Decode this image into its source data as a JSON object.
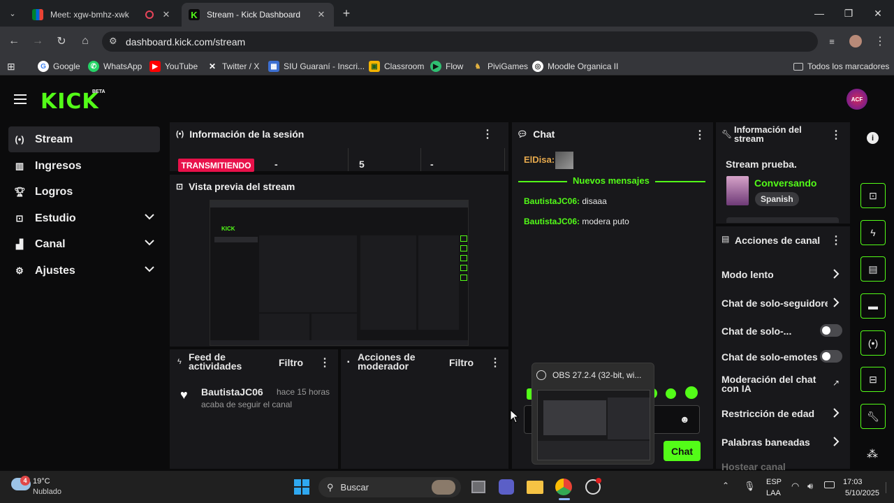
{
  "browser": {
    "tabs": [
      {
        "title": "Meet: xgw-bmhz-xwk",
        "active": false
      },
      {
        "title": "Stream - Kick Dashboard",
        "active": true
      }
    ],
    "url": "dashboard.kick.com/stream",
    "bookmarks": [
      "Google",
      "WhatsApp",
      "YouTube",
      "Twitter / X",
      "SIU Guaraní - Inscri...",
      "Classroom",
      "Flow",
      "PiviGames",
      "Moodle Organica II"
    ],
    "all_bookmarks": "Todos los marcadores"
  },
  "app": {
    "brand": "KICK",
    "beta": "BETA",
    "accent": "#53fc18",
    "avatar_text": "ACF",
    "nav": [
      {
        "label": "Stream",
        "icon": "broadcast-icon",
        "active": true
      },
      {
        "label": "Ingresos",
        "icon": "chart-icon"
      },
      {
        "label": "Logros",
        "icon": "trophy-icon"
      },
      {
        "label": "Estudio",
        "icon": "studio-icon",
        "expandable": true
      },
      {
        "label": "Canal",
        "icon": "user-icon",
        "expandable": true
      },
      {
        "label": "Ajustes",
        "icon": "gear-icon",
        "expandable": true
      }
    ]
  },
  "session": {
    "title": "Información de la sesión",
    "status": "TRANSMITIENDO",
    "stats": [
      "-",
      "5",
      "-"
    ]
  },
  "preview": {
    "title": "Vista previa del stream"
  },
  "feed": {
    "title": "Feed de actividades",
    "filter": "Filtro",
    "items": [
      {
        "user": "BautistaJC06",
        "time": "hace 15 horas",
        "text": "acaba de seguir el canal"
      }
    ]
  },
  "modactions": {
    "title": "Acciones de moderador",
    "filter": "Filtro"
  },
  "chat": {
    "title": "Chat",
    "first_user": "ElDisa:",
    "new_messages": "Nuevos mensajes",
    "messages": [
      {
        "user": "BautistaJC06:",
        "text": "disaaa"
      },
      {
        "user": "BautistaJC06:",
        "text": "modera puto"
      }
    ],
    "send_label": "Chat"
  },
  "streaminfo": {
    "title": "Información del stream",
    "stream_title": "Stream prueba.",
    "category": "Conversando",
    "language": "Spanish"
  },
  "channelactions": {
    "title": "Acciones de canal",
    "items": [
      {
        "label": "Modo lento",
        "control": "chevron"
      },
      {
        "label": "Chat de solo-seguidores",
        "control": "chevron"
      },
      {
        "label": "Chat de solo-...",
        "control": "toggle"
      },
      {
        "label": "Chat de solo-emotes",
        "control": "toggle"
      },
      {
        "label": "Moderación del chat con IA",
        "control": "external"
      },
      {
        "label": "Restricción de edad",
        "control": "chevron"
      },
      {
        "label": "Palabras baneadas",
        "control": "chevron"
      },
      {
        "label": "Hostear canal",
        "control": "none"
      }
    ]
  },
  "obs_popup": {
    "title": "OBS 27.2.4 (32-bit, wi..."
  },
  "taskbar": {
    "weather_temp": "19°C",
    "weather_desc": "Nublado",
    "weather_badge": "4",
    "search": "Buscar",
    "lang1": "ESP",
    "lang2": "LAA",
    "time": "17:03",
    "date": "5/10/2025"
  }
}
